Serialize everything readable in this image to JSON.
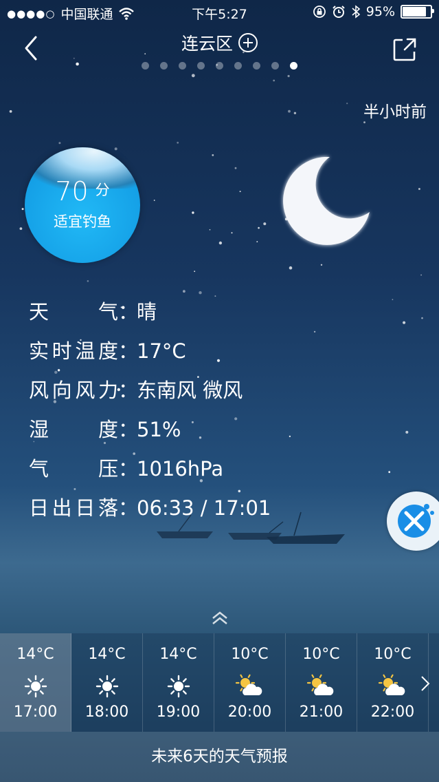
{
  "status_bar": {
    "signal_dots": "●●●●○",
    "carrier": "中国联通",
    "time": "下午5:27",
    "battery_percent": "95%",
    "battery_level": 0.95
  },
  "header": {
    "title": "连云区",
    "page_dots_total": 9,
    "page_dots_active": 8
  },
  "updated_text": "半小时前",
  "fishing": {
    "score": "70",
    "score_unit": "分",
    "suitability": "适宜钓鱼"
  },
  "info_rows": [
    {
      "label_chars": [
        "天",
        "气"
      ],
      "value": "晴"
    },
    {
      "label_chars": [
        "实",
        "时",
        "温",
        "度"
      ],
      "value": "17°C"
    },
    {
      "label_chars": [
        "风",
        "向",
        "风",
        "力"
      ],
      "value": "东南风 微风"
    },
    {
      "label_chars": [
        "湿",
        "度"
      ],
      "value": "51%"
    },
    {
      "label_chars": [
        "气",
        "压"
      ],
      "value": "1016hPa"
    },
    {
      "label_chars": [
        "日",
        "出",
        "日",
        "落"
      ],
      "value": "06:33 / 17:01"
    }
  ],
  "colon": "：",
  "hourly": [
    {
      "temp": "14°C",
      "icon": "sun-icon",
      "time": "17:00"
    },
    {
      "temp": "14°C",
      "icon": "sun-icon",
      "time": "18:00"
    },
    {
      "temp": "14°C",
      "icon": "sun-icon",
      "time": "19:00"
    },
    {
      "temp": "10°C",
      "icon": "partly-cloudy-icon",
      "time": "20:00"
    },
    {
      "temp": "10°C",
      "icon": "partly-cloudy-icon",
      "time": "21:00"
    },
    {
      "temp": "10°C",
      "icon": "partly-cloudy-icon",
      "time": "22:00"
    }
  ],
  "bottom_label": "未来6天的天气预报",
  "colors": {
    "bubble": "#149fe6",
    "sun": "#ffffff",
    "cloud_sun": "#f5c542"
  }
}
